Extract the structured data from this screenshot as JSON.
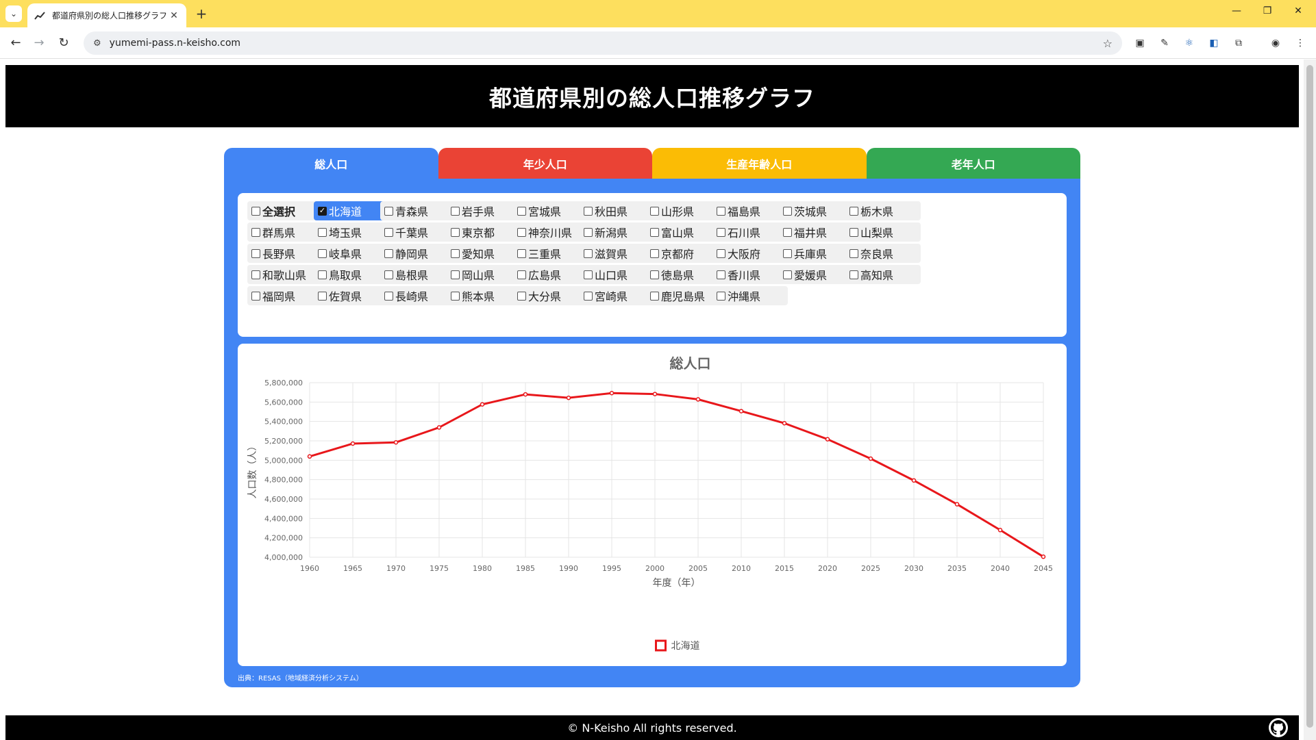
{
  "browser": {
    "tab_title": "都道府県別の総人口推移グラフ",
    "url": "yumemi-pass.n-keisho.com"
  },
  "header": {
    "title": "都道府県別の総人口推移グラフ"
  },
  "tabs": [
    {
      "label": "総人口",
      "color": "#4285f4"
    },
    {
      "label": "年少人口",
      "color": "#ea4335"
    },
    {
      "label": "生産年齢人口",
      "color": "#fbbc05"
    },
    {
      "label": "老年人口",
      "color": "#34a853"
    }
  ],
  "select_all": {
    "label": "全選択",
    "checked": false
  },
  "prefectures": [
    {
      "label": "北海道",
      "checked": true
    },
    {
      "label": "青森県",
      "checked": false
    },
    {
      "label": "岩手県",
      "checked": false
    },
    {
      "label": "宮城県",
      "checked": false
    },
    {
      "label": "秋田県",
      "checked": false
    },
    {
      "label": "山形県",
      "checked": false
    },
    {
      "label": "福島県",
      "checked": false
    },
    {
      "label": "茨城県",
      "checked": false
    },
    {
      "label": "栃木県",
      "checked": false
    },
    {
      "label": "群馬県",
      "checked": false
    },
    {
      "label": "埼玉県",
      "checked": false
    },
    {
      "label": "千葉県",
      "checked": false
    },
    {
      "label": "東京都",
      "checked": false
    },
    {
      "label": "神奈川県",
      "checked": false
    },
    {
      "label": "新潟県",
      "checked": false
    },
    {
      "label": "富山県",
      "checked": false
    },
    {
      "label": "石川県",
      "checked": false
    },
    {
      "label": "福井県",
      "checked": false
    },
    {
      "label": "山梨県",
      "checked": false
    },
    {
      "label": "長野県",
      "checked": false
    },
    {
      "label": "岐阜県",
      "checked": false
    },
    {
      "label": "静岡県",
      "checked": false
    },
    {
      "label": "愛知県",
      "checked": false
    },
    {
      "label": "三重県",
      "checked": false
    },
    {
      "label": "滋賀県",
      "checked": false
    },
    {
      "label": "京都府",
      "checked": false
    },
    {
      "label": "大阪府",
      "checked": false
    },
    {
      "label": "兵庫県",
      "checked": false
    },
    {
      "label": "奈良県",
      "checked": false
    },
    {
      "label": "和歌山県",
      "checked": false
    },
    {
      "label": "鳥取県",
      "checked": false
    },
    {
      "label": "島根県",
      "checked": false
    },
    {
      "label": "岡山県",
      "checked": false
    },
    {
      "label": "広島県",
      "checked": false
    },
    {
      "label": "山口県",
      "checked": false
    },
    {
      "label": "徳島県",
      "checked": false
    },
    {
      "label": "香川県",
      "checked": false
    },
    {
      "label": "愛媛県",
      "checked": false
    },
    {
      "label": "高知県",
      "checked": false
    },
    {
      "label": "福岡県",
      "checked": false
    },
    {
      "label": "佐賀県",
      "checked": false
    },
    {
      "label": "長崎県",
      "checked": false
    },
    {
      "label": "熊本県",
      "checked": false
    },
    {
      "label": "大分県",
      "checked": false
    },
    {
      "label": "宮崎県",
      "checked": false
    },
    {
      "label": "鹿児島県",
      "checked": false
    },
    {
      "label": "沖縄県",
      "checked": false
    }
  ],
  "chart_data": {
    "type": "line",
    "title": "総人口",
    "xlabel": "年度（年）",
    "ylabel": "人口数（人）",
    "x": [
      1960,
      1965,
      1970,
      1975,
      1980,
      1985,
      1990,
      1995,
      2000,
      2005,
      2010,
      2015,
      2020,
      2025,
      2030,
      2035,
      2040,
      2045
    ],
    "ylim": [
      4000000,
      5800000
    ],
    "yticks": [
      4000000,
      4200000,
      4400000,
      4600000,
      4800000,
      5000000,
      5200000,
      5400000,
      5600000,
      5800000
    ],
    "grid": true,
    "legend_position": "bottom",
    "series": [
      {
        "name": "北海道",
        "color": "#e8171b",
        "values": [
          5039206,
          5171800,
          5184287,
          5338206,
          5575989,
          5679439,
          5643647,
          5692321,
          5683062,
          5627737,
          5506419,
          5381733,
          5216615,
          5016554,
          4791592,
          4546357,
          4280427,
          4004973
        ]
      }
    ]
  },
  "source": "出典：RESAS（地域経済分析システム）",
  "footer": {
    "copyright": "© N-Keisho All rights reserved."
  }
}
